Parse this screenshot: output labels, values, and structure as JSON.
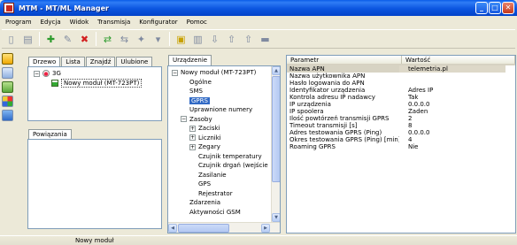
{
  "window": {
    "title": "MTM - MT/ML Manager"
  },
  "menu": [
    "Program",
    "Edycja",
    "Widok",
    "Transmisja",
    "Konfigurator",
    "Pomoc"
  ],
  "left_tabs": [
    "Drzewo",
    "Lista",
    "Znajdź",
    "Ulubione"
  ],
  "tree": {
    "root": "3G",
    "child": "Nowy moduł (MT-723PT)"
  },
  "relations_tab": "Powiązania",
  "device_tab": "Urządzenie",
  "device_tree": [
    {
      "label": "Nowy moduł (MT-723PT)",
      "level": 0,
      "expander": "-"
    },
    {
      "label": "Ogólne",
      "level": 1
    },
    {
      "label": "SMS",
      "level": 1
    },
    {
      "label": "GPRS",
      "level": 1,
      "selected": true
    },
    {
      "label": "Uprawnione numery",
      "level": 1
    },
    {
      "label": "Zasoby",
      "level": 1,
      "expander": "-"
    },
    {
      "label": "Zaciski",
      "level": 2,
      "expander": "+"
    },
    {
      "label": "Liczniki",
      "level": 2,
      "expander": "+"
    },
    {
      "label": "Zegary",
      "level": 2,
      "expander": "+"
    },
    {
      "label": "Czujnik temperatury",
      "level": 2
    },
    {
      "label": "Czujnik drgań (wejście",
      "level": 2
    },
    {
      "label": "Zasilanie",
      "level": 2
    },
    {
      "label": "GPS",
      "level": 2
    },
    {
      "label": "Rejestrator",
      "level": 2
    },
    {
      "label": "Zdarzenia",
      "level": 1
    },
    {
      "label": "Aktywności GSM",
      "level": 1
    }
  ],
  "grid": {
    "headers": [
      "Parametr",
      "Wartość"
    ],
    "rows": [
      {
        "name": "Nazwa APN",
        "value": "telemetria.pl",
        "selected": true
      },
      {
        "name": "Nazwa użytkownika APN",
        "value": ""
      },
      {
        "name": "Hasło logowania do APN",
        "value": ""
      },
      {
        "name": "Identyfikator urządzenia",
        "value": "Adres IP"
      },
      {
        "name": "Kontrola adresu IP nadawcy",
        "value": "Tak"
      },
      {
        "name": "IP urządzenia",
        "value": "0.0.0.0"
      },
      {
        "name": "IP spoolera",
        "value": "Żaden"
      },
      {
        "name": "Ilość powtórzeń transmisji GPRS",
        "value": "2"
      },
      {
        "name": "Timeout transmisji [s]",
        "value": "8"
      },
      {
        "name": "Adres testowania GPRS (Ping)",
        "value": "0.0.0.0"
      },
      {
        "name": "Okres testowania GPRS (Ping) [min]",
        "value": "4"
      },
      {
        "name": "Roaming GPRS",
        "value": "Nie"
      }
    ]
  },
  "status": {
    "text": "Nowy moduł"
  },
  "colors": {
    "titlebar": "#0a5ce8",
    "selection": "#316ac5",
    "accent_red": "#d21f1f"
  }
}
